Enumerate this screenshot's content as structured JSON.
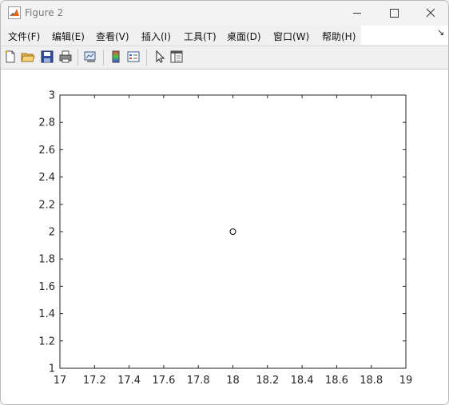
{
  "window": {
    "title": "Figure 2"
  },
  "menu": {
    "items": [
      {
        "label": "文件(F)"
      },
      {
        "label": "编辑(E)"
      },
      {
        "label": "查看(V)"
      },
      {
        "label": "插入(I)"
      },
      {
        "label": "工具(T)"
      },
      {
        "label": "桌面(D)"
      },
      {
        "label": "窗口(W)"
      },
      {
        "label": "帮助(H)"
      }
    ],
    "overflow_glyph": "↘"
  },
  "toolbar": {
    "buttons": [
      {
        "icon": "new-figure-icon"
      },
      {
        "icon": "open-file-icon"
      },
      {
        "icon": "save-icon"
      },
      {
        "icon": "print-icon"
      },
      {
        "icon": "link-plot-icon"
      },
      {
        "icon": "insert-colorbar-icon"
      },
      {
        "icon": "insert-legend-icon"
      },
      {
        "icon": "edit-plot-arrow-icon"
      },
      {
        "icon": "property-inspector-icon"
      }
    ]
  },
  "chart_data": {
    "type": "scatter",
    "title": "",
    "xlabel": "",
    "ylabel": "",
    "xlim": [
      17,
      19
    ],
    "ylim": [
      1,
      3
    ],
    "xticks": [
      "17",
      "17.2",
      "17.4",
      "17.6",
      "17.8",
      "18",
      "18.2",
      "18.4",
      "18.6",
      "18.8",
      "19"
    ],
    "yticks": [
      "1",
      "1.2",
      "1.4",
      "1.6",
      "1.8",
      "2",
      "2.2",
      "2.4",
      "2.6",
      "2.8",
      "3"
    ],
    "points": [
      {
        "x": 18,
        "y": 2
      }
    ],
    "marker": "circle-open",
    "marker_color": "#000000",
    "grid": false
  }
}
